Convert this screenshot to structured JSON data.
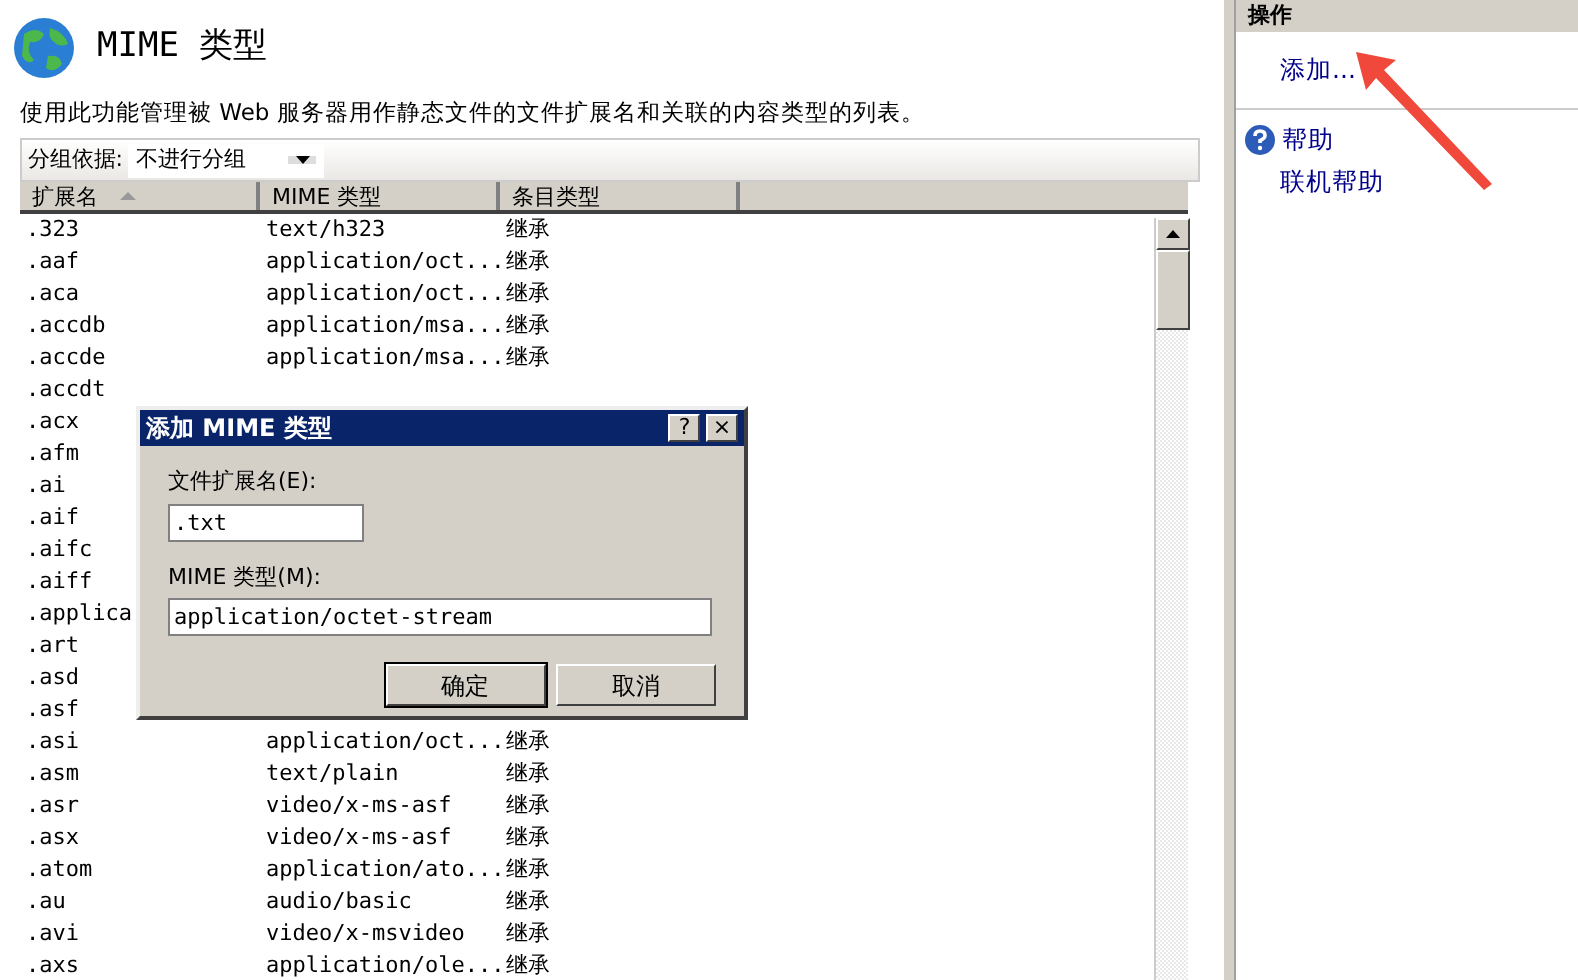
{
  "page": {
    "title": "MIME 类型",
    "description": "使用此功能管理被 Web 服务器用作静态文件的文件扩展名和关联的内容类型的列表。",
    "group_by": {
      "label": "分组依据:",
      "value": "不进行分组"
    }
  },
  "table": {
    "columns": [
      {
        "label": "扩展名",
        "sorted": true
      },
      {
        "label": "MIME 类型",
        "sorted": false
      },
      {
        "label": "条目类型",
        "sorted": false
      }
    ],
    "rows": [
      {
        "ext": ".323",
        "mime": "text/h323",
        "type": "继承"
      },
      {
        "ext": ".aaf",
        "mime": "application/oct...",
        "type": "继承"
      },
      {
        "ext": ".aca",
        "mime": "application/oct...",
        "type": "继承"
      },
      {
        "ext": ".accdb",
        "mime": "application/msa...",
        "type": "继承"
      },
      {
        "ext": ".accde",
        "mime": "application/msa...",
        "type": "继承"
      },
      {
        "ext": ".accdt"
      },
      {
        "ext": ".acx"
      },
      {
        "ext": ".afm"
      },
      {
        "ext": ".ai"
      },
      {
        "ext": ".aif"
      },
      {
        "ext": ".aifc"
      },
      {
        "ext": ".aiff"
      },
      {
        "ext": ".applica"
      },
      {
        "ext": ".art"
      },
      {
        "ext": ".asd"
      },
      {
        "ext": ".asf"
      },
      {
        "ext": ".asi",
        "mime": "application/oct...",
        "type": "继承"
      },
      {
        "ext": ".asm",
        "mime": "text/plain",
        "type": "继承"
      },
      {
        "ext": ".asr",
        "mime": "video/x-ms-asf",
        "type": "继承"
      },
      {
        "ext": ".asx",
        "mime": "video/x-ms-asf",
        "type": "继承"
      },
      {
        "ext": ".atom",
        "mime": "application/ato...",
        "type": "继承"
      },
      {
        "ext": ".au",
        "mime": "audio/basic",
        "type": "继承"
      },
      {
        "ext": ".avi",
        "mime": "video/x-msvideo",
        "type": "继承"
      },
      {
        "ext": ".axs",
        "mime": "application/ole...",
        "type": "继承"
      }
    ]
  },
  "dialog": {
    "title": "添加 MIME 类型",
    "help": "?",
    "close": "×",
    "fields": [
      {
        "label": "文件扩展名(E):",
        "value": ".txt"
      },
      {
        "label": "MIME 类型(M):",
        "value": "application/octet-stream"
      }
    ],
    "buttons": [
      "确定",
      "取消"
    ]
  },
  "actions": {
    "title": "操作",
    "groups": [
      [
        {
          "label": "添加...",
          "kind": "plain"
        }
      ],
      [
        {
          "label": "帮助",
          "kind": "help"
        },
        {
          "label": "联机帮助",
          "kind": "plain"
        }
      ]
    ]
  }
}
